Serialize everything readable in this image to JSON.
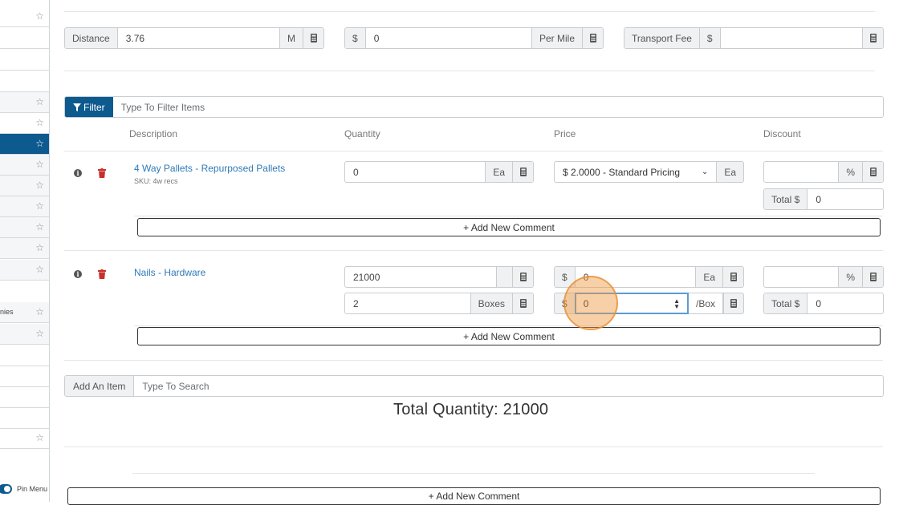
{
  "sidebar": {
    "rows": [
      {
        "star": "☆",
        "text": ""
      },
      {
        "star": "",
        "text": ""
      },
      {
        "star": "",
        "text": ""
      },
      {
        "star": "",
        "text": ""
      },
      {
        "star": "☆",
        "text": ""
      },
      {
        "star": "☆",
        "text": ""
      },
      {
        "star": "☆",
        "text": ""
      },
      {
        "star": "☆",
        "text": ""
      },
      {
        "star": "☆",
        "text": ""
      },
      {
        "star": "☆",
        "text": ""
      },
      {
        "star": "☆",
        "text": ""
      },
      {
        "star": "☆",
        "text": ""
      },
      {
        "star": "☆",
        "text": ""
      },
      {
        "star": "☆",
        "text": "nies"
      },
      {
        "star": "☆",
        "text": ""
      },
      {
        "star": "☆",
        "text": ""
      }
    ],
    "pin_label": "Pin Menu",
    "accent": "#0d5a8f"
  },
  "transport": {
    "distance_label": "Distance",
    "distance_value": "3.76",
    "distance_unit": "M",
    "rate_currency": "$",
    "rate_value": "0",
    "rate_unit": "Per Mile",
    "fee_label": "Transport Fee",
    "fee_currency": "$",
    "fee_value": ""
  },
  "filter": {
    "button_label": "Filter",
    "placeholder": "Type To Filter Items"
  },
  "columns": {
    "description": "Description",
    "quantity": "Quantity",
    "price": "Price",
    "discount": "Discount"
  },
  "items": [
    {
      "name": "4 Way Pallets - Repurposed Pallets",
      "sku": "SKU: 4w recs",
      "quantity": "0",
      "quantity_unit": "Ea",
      "price_select": "$ 2.0000 - Standard Pricing",
      "price_unit": "Ea",
      "discount_value": "",
      "discount_unit": "%",
      "total_label": "Total $",
      "total_value": "0",
      "comment_label": "+ Add New Comment"
    },
    {
      "name": "Nails - Hardware",
      "quantity": "21000",
      "quantity_unit": "",
      "price_currency": "$",
      "price_value": "0",
      "price_unit": "Ea",
      "box_quantity": "2",
      "box_unit": "Boxes",
      "box_price_currency": "$",
      "box_price_value": "0",
      "box_price_unit": "/Box",
      "discount_value": "",
      "discount_unit": "%",
      "total_label": "Total $",
      "total_value": "0",
      "comment_label": "+ Add New Comment"
    }
  ],
  "add_item": {
    "label": "Add An Item",
    "placeholder": "Type To Search"
  },
  "total_quantity": "Total Quantity: 21000",
  "bottom_comment_label": "+ Add New Comment"
}
